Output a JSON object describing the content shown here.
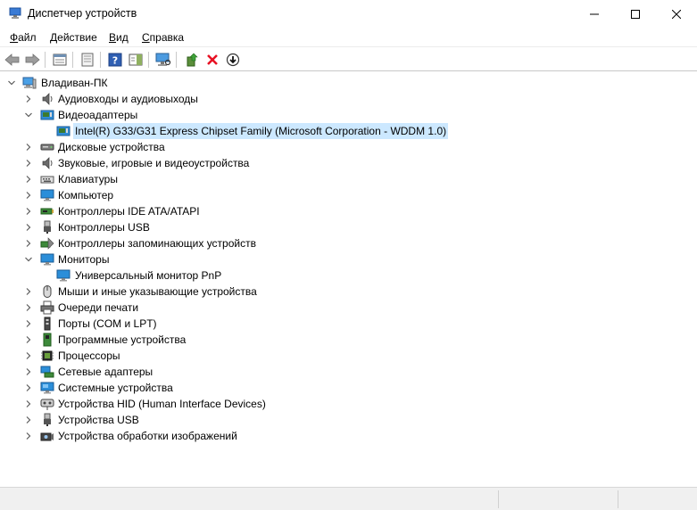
{
  "window": {
    "title": "Диспетчер устройств",
    "icon": "device-manager-icon"
  },
  "menu": [
    {
      "label": "Файл",
      "accel": "Ф",
      "rest": "айл"
    },
    {
      "label": "Действие",
      "accel": "Д",
      "rest": "ействие"
    },
    {
      "label": "Вид",
      "accel": "В",
      "rest": "ид"
    },
    {
      "label": "Справка",
      "accel": "С",
      "rest": "правка"
    }
  ],
  "toolbar": [
    "back-arrow-icon",
    "forward-arrow-icon",
    "properties-panel-icon",
    "show-hidden-icon",
    "help-icon",
    "action-pane-icon",
    "scan-hardware-icon",
    "update-driver-icon",
    "uninstall-device-icon",
    "disable-device-icon"
  ],
  "colors": {
    "selection": "#cce8ff",
    "remove_red": "#e81123",
    "monitor_blue": "#2b8ed9"
  },
  "tree": {
    "root": {
      "label": "Владиван-ПК",
      "expanded": true
    },
    "items": [
      {
        "label": "Аудиовходы и аудиовыходы",
        "expanded": false,
        "icon": "speaker-icon"
      },
      {
        "label": "Видеоадаптеры",
        "expanded": true,
        "icon": "display-adapter-icon",
        "children": [
          {
            "label": "Intel(R) G33/G31 Express Chipset Family (Microsoft Corporation - WDDM 1.0)",
            "icon": "display-adapter-icon",
            "selected": true
          }
        ]
      },
      {
        "label": "Дисковые устройства",
        "expanded": false,
        "icon": "disk-drive-icon"
      },
      {
        "label": "Звуковые, игровые и видеоустройства",
        "expanded": false,
        "icon": "speaker-icon"
      },
      {
        "label": "Клавиатуры",
        "expanded": false,
        "icon": "keyboard-icon"
      },
      {
        "label": "Компьютер",
        "expanded": false,
        "icon": "monitor-icon"
      },
      {
        "label": "Контроллеры IDE ATA/ATAPI",
        "expanded": false,
        "icon": "ide-controller-icon"
      },
      {
        "label": "Контроллеры USB",
        "expanded": false,
        "icon": "usb-icon"
      },
      {
        "label": "Контроллеры запоминающих устройств",
        "expanded": false,
        "icon": "storage-controller-icon"
      },
      {
        "label": "Мониторы",
        "expanded": true,
        "icon": "monitor-icon",
        "children": [
          {
            "label": "Универсальный монитор PnP",
            "icon": "monitor-icon",
            "selected": false
          }
        ]
      },
      {
        "label": "Мыши и иные указывающие устройства",
        "expanded": false,
        "icon": "mouse-icon"
      },
      {
        "label": "Очереди печати",
        "expanded": false,
        "icon": "printer-icon"
      },
      {
        "label": "Порты (COM и LPT)",
        "expanded": false,
        "icon": "port-icon"
      },
      {
        "label": "Программные устройства",
        "expanded": false,
        "icon": "software-device-icon"
      },
      {
        "label": "Процессоры",
        "expanded": false,
        "icon": "processor-icon"
      },
      {
        "label": "Сетевые адаптеры",
        "expanded": false,
        "icon": "network-adapter-icon"
      },
      {
        "label": "Системные устройства",
        "expanded": false,
        "icon": "system-device-icon"
      },
      {
        "label": "Устройства HID (Human Interface Devices)",
        "expanded": false,
        "icon": "hid-icon"
      },
      {
        "label": "Устройства USB",
        "expanded": false,
        "icon": "usb-icon"
      },
      {
        "label": "Устройства обработки изображений",
        "expanded": false,
        "icon": "camera-icon"
      }
    ]
  }
}
